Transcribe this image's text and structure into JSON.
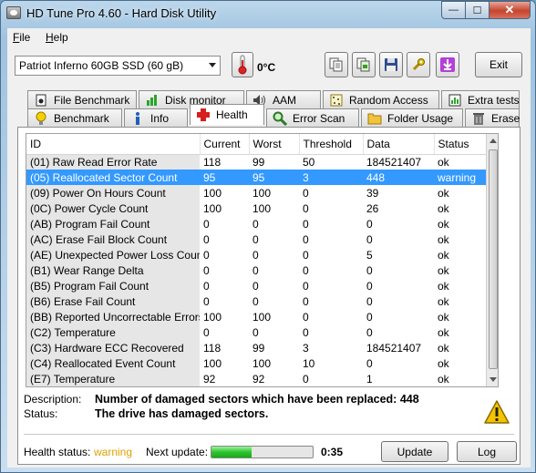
{
  "window": {
    "title": "HD Tune Pro 4.60 - Hard Disk Utility"
  },
  "menu": [
    {
      "label": "File",
      "key": "F",
      "rest": "ile"
    },
    {
      "label": "Help",
      "key": "H",
      "rest": "elp"
    }
  ],
  "toolbar": {
    "drive": "Patriot Inferno 60GB SSD (60 gB)",
    "temperature": "0°C",
    "exit_label": "Exit"
  },
  "tabs_top": [
    {
      "label": "File Benchmark",
      "icon": "file-benchmark-icon"
    },
    {
      "label": "Disk monitor",
      "icon": "disk-monitor-icon"
    },
    {
      "label": "AAM",
      "icon": "speaker-icon"
    },
    {
      "label": "Random Access",
      "icon": "random-access-icon"
    },
    {
      "label": "Extra tests",
      "icon": "extra-tests-icon"
    }
  ],
  "tabs_bottom": [
    {
      "label": "Benchmark",
      "icon": "benchmark-icon"
    },
    {
      "label": "Info",
      "icon": "info-icon"
    },
    {
      "label": "Health",
      "icon": "health-icon",
      "active": true
    },
    {
      "label": "Error Scan",
      "icon": "error-scan-icon"
    },
    {
      "label": "Folder Usage",
      "icon": "folder-icon"
    },
    {
      "label": "Erase",
      "icon": "trash-icon"
    }
  ],
  "table": {
    "columns": [
      "ID",
      "Current",
      "Worst",
      "Threshold",
      "Data",
      "Status"
    ],
    "rows": [
      [
        "(01) Raw Read Error Rate",
        "118",
        "99",
        "50",
        "184521407",
        "ok"
      ],
      [
        "(05) Reallocated Sector Count",
        "95",
        "95",
        "3",
        "448",
        "warning"
      ],
      [
        "(09) Power On Hours Count",
        "100",
        "100",
        "0",
        "39",
        "ok"
      ],
      [
        "(0C) Power Cycle Count",
        "100",
        "100",
        "0",
        "26",
        "ok"
      ],
      [
        "(AB) Program Fail Count",
        "0",
        "0",
        "0",
        "0",
        "ok"
      ],
      [
        "(AC) Erase Fail Block Count",
        "0",
        "0",
        "0",
        "0",
        "ok"
      ],
      [
        "(AE) Unexpected Power Loss Count",
        "0",
        "0",
        "0",
        "5",
        "ok"
      ],
      [
        "(B1) Wear Range Delta",
        "0",
        "0",
        "0",
        "0",
        "ok"
      ],
      [
        "(B5) Program Fail Count",
        "0",
        "0",
        "0",
        "0",
        "ok"
      ],
      [
        "(B6) Erase Fail Count",
        "0",
        "0",
        "0",
        "0",
        "ok"
      ],
      [
        "(BB) Reported Uncorrectable Errors",
        "100",
        "100",
        "0",
        "0",
        "ok"
      ],
      [
        "(C2) Temperature",
        "0",
        "0",
        "0",
        "0",
        "ok"
      ],
      [
        "(C3) Hardware ECC Recovered",
        "118",
        "99",
        "3",
        "184521407",
        "ok"
      ],
      [
        "(C4) Reallocated Event Count",
        "100",
        "100",
        "10",
        "0",
        "ok"
      ],
      [
        "(E7) Temperature",
        "92",
        "92",
        "0",
        "1",
        "ok"
      ]
    ],
    "selected_row": 1
  },
  "details": {
    "description_label": "Description:",
    "description_value": "Number of damaged sectors which have been replaced: 448",
    "status_label": "Status:",
    "status_value": "The drive has damaged sectors."
  },
  "footer": {
    "health_label": "Health status:",
    "health_value": "warning",
    "next_update_label": "Next update:",
    "progress_fraction": 0.4,
    "time": "0:35",
    "update_label": "Update",
    "log_label": "Log"
  },
  "colors": {
    "selection": "#3399ff",
    "warning_text": "#e0a000",
    "progress": "#2fc52f"
  }
}
